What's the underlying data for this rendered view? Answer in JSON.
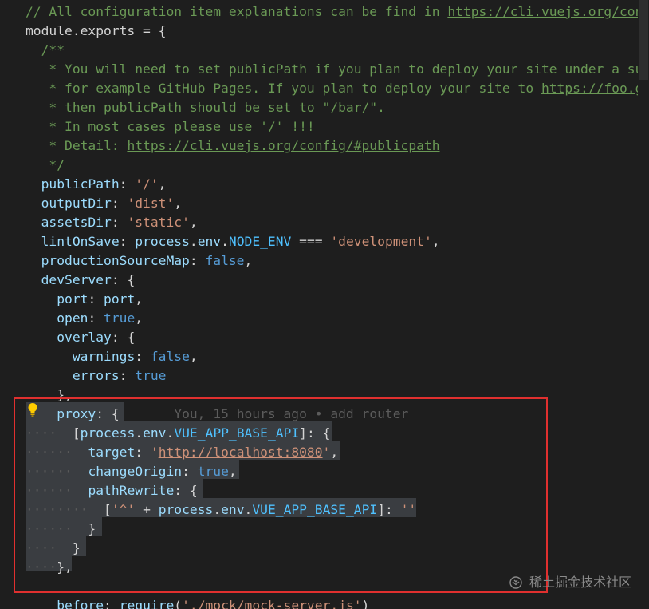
{
  "editor": {
    "lines": [
      [
        [
          "c-comment",
          "// All configuration item explanations can be find in "
        ],
        [
          "c-link",
          "https://cli.vuejs.org/config/"
        ]
      ],
      [
        [
          "c-plain",
          "module.exports = {"
        ]
      ],
      [
        [
          "c-comment",
          "  /**"
        ]
      ],
      [
        [
          "c-comment",
          "   * You will need to set publicPath if you plan to deploy your site under a sub path,"
        ]
      ],
      [
        [
          "c-comment",
          "   * for example GitHub Pages. If you plan to deploy your site to "
        ],
        [
          "c-link",
          "https://foo.github.io/bar/"
        ],
        [
          "c-comment",
          ","
        ]
      ],
      [
        [
          "c-comment",
          "   * then publicPath should be set to \"/bar/\"."
        ]
      ],
      [
        [
          "c-comment",
          "   * In most cases please use '/' !!!"
        ]
      ],
      [
        [
          "c-comment",
          "   * Detail: "
        ],
        [
          "c-link",
          "https://cli.vuejs.org/config/#publicpath"
        ]
      ],
      [
        [
          "c-comment",
          "   */"
        ]
      ],
      [
        [
          "c-plain",
          "  "
        ],
        [
          "c-key",
          "publicPath"
        ],
        [
          "c-plain",
          ": "
        ],
        [
          "c-str",
          "'/'"
        ],
        [
          "c-plain",
          ","
        ]
      ],
      [
        [
          "c-plain",
          "  "
        ],
        [
          "c-key",
          "outputDir"
        ],
        [
          "c-plain",
          ": "
        ],
        [
          "c-str",
          "'dist'"
        ],
        [
          "c-plain",
          ","
        ]
      ],
      [
        [
          "c-plain",
          "  "
        ],
        [
          "c-key",
          "assetsDir"
        ],
        [
          "c-plain",
          ": "
        ],
        [
          "c-str",
          "'static'"
        ],
        [
          "c-plain",
          ","
        ]
      ],
      [
        [
          "c-plain",
          "  "
        ],
        [
          "c-key",
          "lintOnSave"
        ],
        [
          "c-plain",
          ": "
        ],
        [
          "c-key",
          "process"
        ],
        [
          "c-plain",
          "."
        ],
        [
          "c-key",
          "env"
        ],
        [
          "c-plain",
          "."
        ],
        [
          "c-const",
          "NODE_ENV"
        ],
        [
          "c-plain",
          " === "
        ],
        [
          "c-str",
          "'development'"
        ],
        [
          "c-plain",
          ","
        ]
      ],
      [
        [
          "c-plain",
          "  "
        ],
        [
          "c-key",
          "productionSourceMap"
        ],
        [
          "c-plain",
          ": "
        ],
        [
          "c-kw",
          "false"
        ],
        [
          "c-plain",
          ","
        ]
      ],
      [
        [
          "c-plain",
          "  "
        ],
        [
          "c-key",
          "devServer"
        ],
        [
          "c-plain",
          ": {"
        ]
      ],
      [
        [
          "c-plain",
          "    "
        ],
        [
          "c-key",
          "port"
        ],
        [
          "c-plain",
          ": "
        ],
        [
          "c-key",
          "port"
        ],
        [
          "c-plain",
          ","
        ]
      ],
      [
        [
          "c-plain",
          "    "
        ],
        [
          "c-key",
          "open"
        ],
        [
          "c-plain",
          ": "
        ],
        [
          "c-kw",
          "true"
        ],
        [
          "c-plain",
          ","
        ]
      ],
      [
        [
          "c-plain",
          "    "
        ],
        [
          "c-key",
          "overlay"
        ],
        [
          "c-plain",
          ": {"
        ]
      ],
      [
        [
          "c-plain",
          "      "
        ],
        [
          "c-key",
          "warnings"
        ],
        [
          "c-plain",
          ": "
        ],
        [
          "c-kw",
          "false"
        ],
        [
          "c-plain",
          ","
        ]
      ],
      [
        [
          "c-plain",
          "      "
        ],
        [
          "c-key",
          "errors"
        ],
        [
          "c-plain",
          ": "
        ],
        [
          "c-kw",
          "true"
        ]
      ],
      [
        [
          "c-plain",
          "    },"
        ]
      ],
      [
        [
          "c-plain",
          "    "
        ],
        [
          "c-key",
          "proxy"
        ],
        [
          "c-plain",
          ": {"
        ],
        [
          "c-blame",
          "       You, 15 hours ago • add router"
        ]
      ],
      [
        [
          "dots",
          "····"
        ],
        [
          "c-plain",
          "  ["
        ],
        [
          "c-key",
          "process"
        ],
        [
          "c-plain",
          "."
        ],
        [
          "c-key",
          "env"
        ],
        [
          "c-plain",
          "."
        ],
        [
          "c-const",
          "VUE_APP_BASE_API"
        ],
        [
          "c-plain",
          "]: {"
        ]
      ],
      [
        [
          "dots",
          "······"
        ],
        [
          "c-plain",
          "  "
        ],
        [
          "c-key",
          "target"
        ],
        [
          "c-plain",
          ": "
        ],
        [
          "c-str",
          "'"
        ],
        [
          "c-url",
          "http://localhost:8080"
        ],
        [
          "c-str",
          "'"
        ],
        [
          "c-plain",
          ","
        ]
      ],
      [
        [
          "dots",
          "······"
        ],
        [
          "c-plain",
          "  "
        ],
        [
          "c-key",
          "changeOrigin"
        ],
        [
          "c-plain",
          ": "
        ],
        [
          "c-kw",
          "true"
        ],
        [
          "c-plain",
          ","
        ]
      ],
      [
        [
          "dots",
          "······"
        ],
        [
          "c-plain",
          "  "
        ],
        [
          "c-key",
          "pathRewrite"
        ],
        [
          "c-plain",
          ": {"
        ]
      ],
      [
        [
          "dots",
          "········"
        ],
        [
          "c-plain",
          "  ["
        ],
        [
          "c-str",
          "'^'"
        ],
        [
          "c-plain",
          " + "
        ],
        [
          "c-key",
          "process"
        ],
        [
          "c-plain",
          "."
        ],
        [
          "c-key",
          "env"
        ],
        [
          "c-plain",
          "."
        ],
        [
          "c-const",
          "VUE_APP_BASE_API"
        ],
        [
          "c-plain",
          "]: "
        ],
        [
          "c-str",
          "''"
        ]
      ],
      [
        [
          "dots",
          "······"
        ],
        [
          "c-plain",
          "  }"
        ]
      ],
      [
        [
          "dots",
          "····"
        ],
        [
          "c-plain",
          "  }"
        ]
      ],
      [
        [
          "dots",
          "····"
        ],
        [
          "c-plain",
          "},"
        ]
      ],
      [
        [
          "c-plain",
          ""
        ]
      ],
      [
        [
          "c-plain",
          "    "
        ],
        [
          "c-key",
          "before"
        ],
        [
          "c-plain",
          ": "
        ],
        [
          "c-key",
          "require"
        ],
        [
          "c-plain",
          "("
        ],
        [
          "c-str",
          "'./mock/mock-server.js'"
        ],
        [
          "c-plain",
          ")"
        ]
      ]
    ]
  },
  "watermark": {
    "text": "稀土掘金技术社区"
  },
  "colors": {
    "background": "#1e1e1e",
    "highlight_border": "#e0302f",
    "selection": "#3a3d41"
  },
  "icons": {
    "lightbulb": "lightbulb-icon",
    "watermark_logo": "juejin-logo-icon"
  }
}
